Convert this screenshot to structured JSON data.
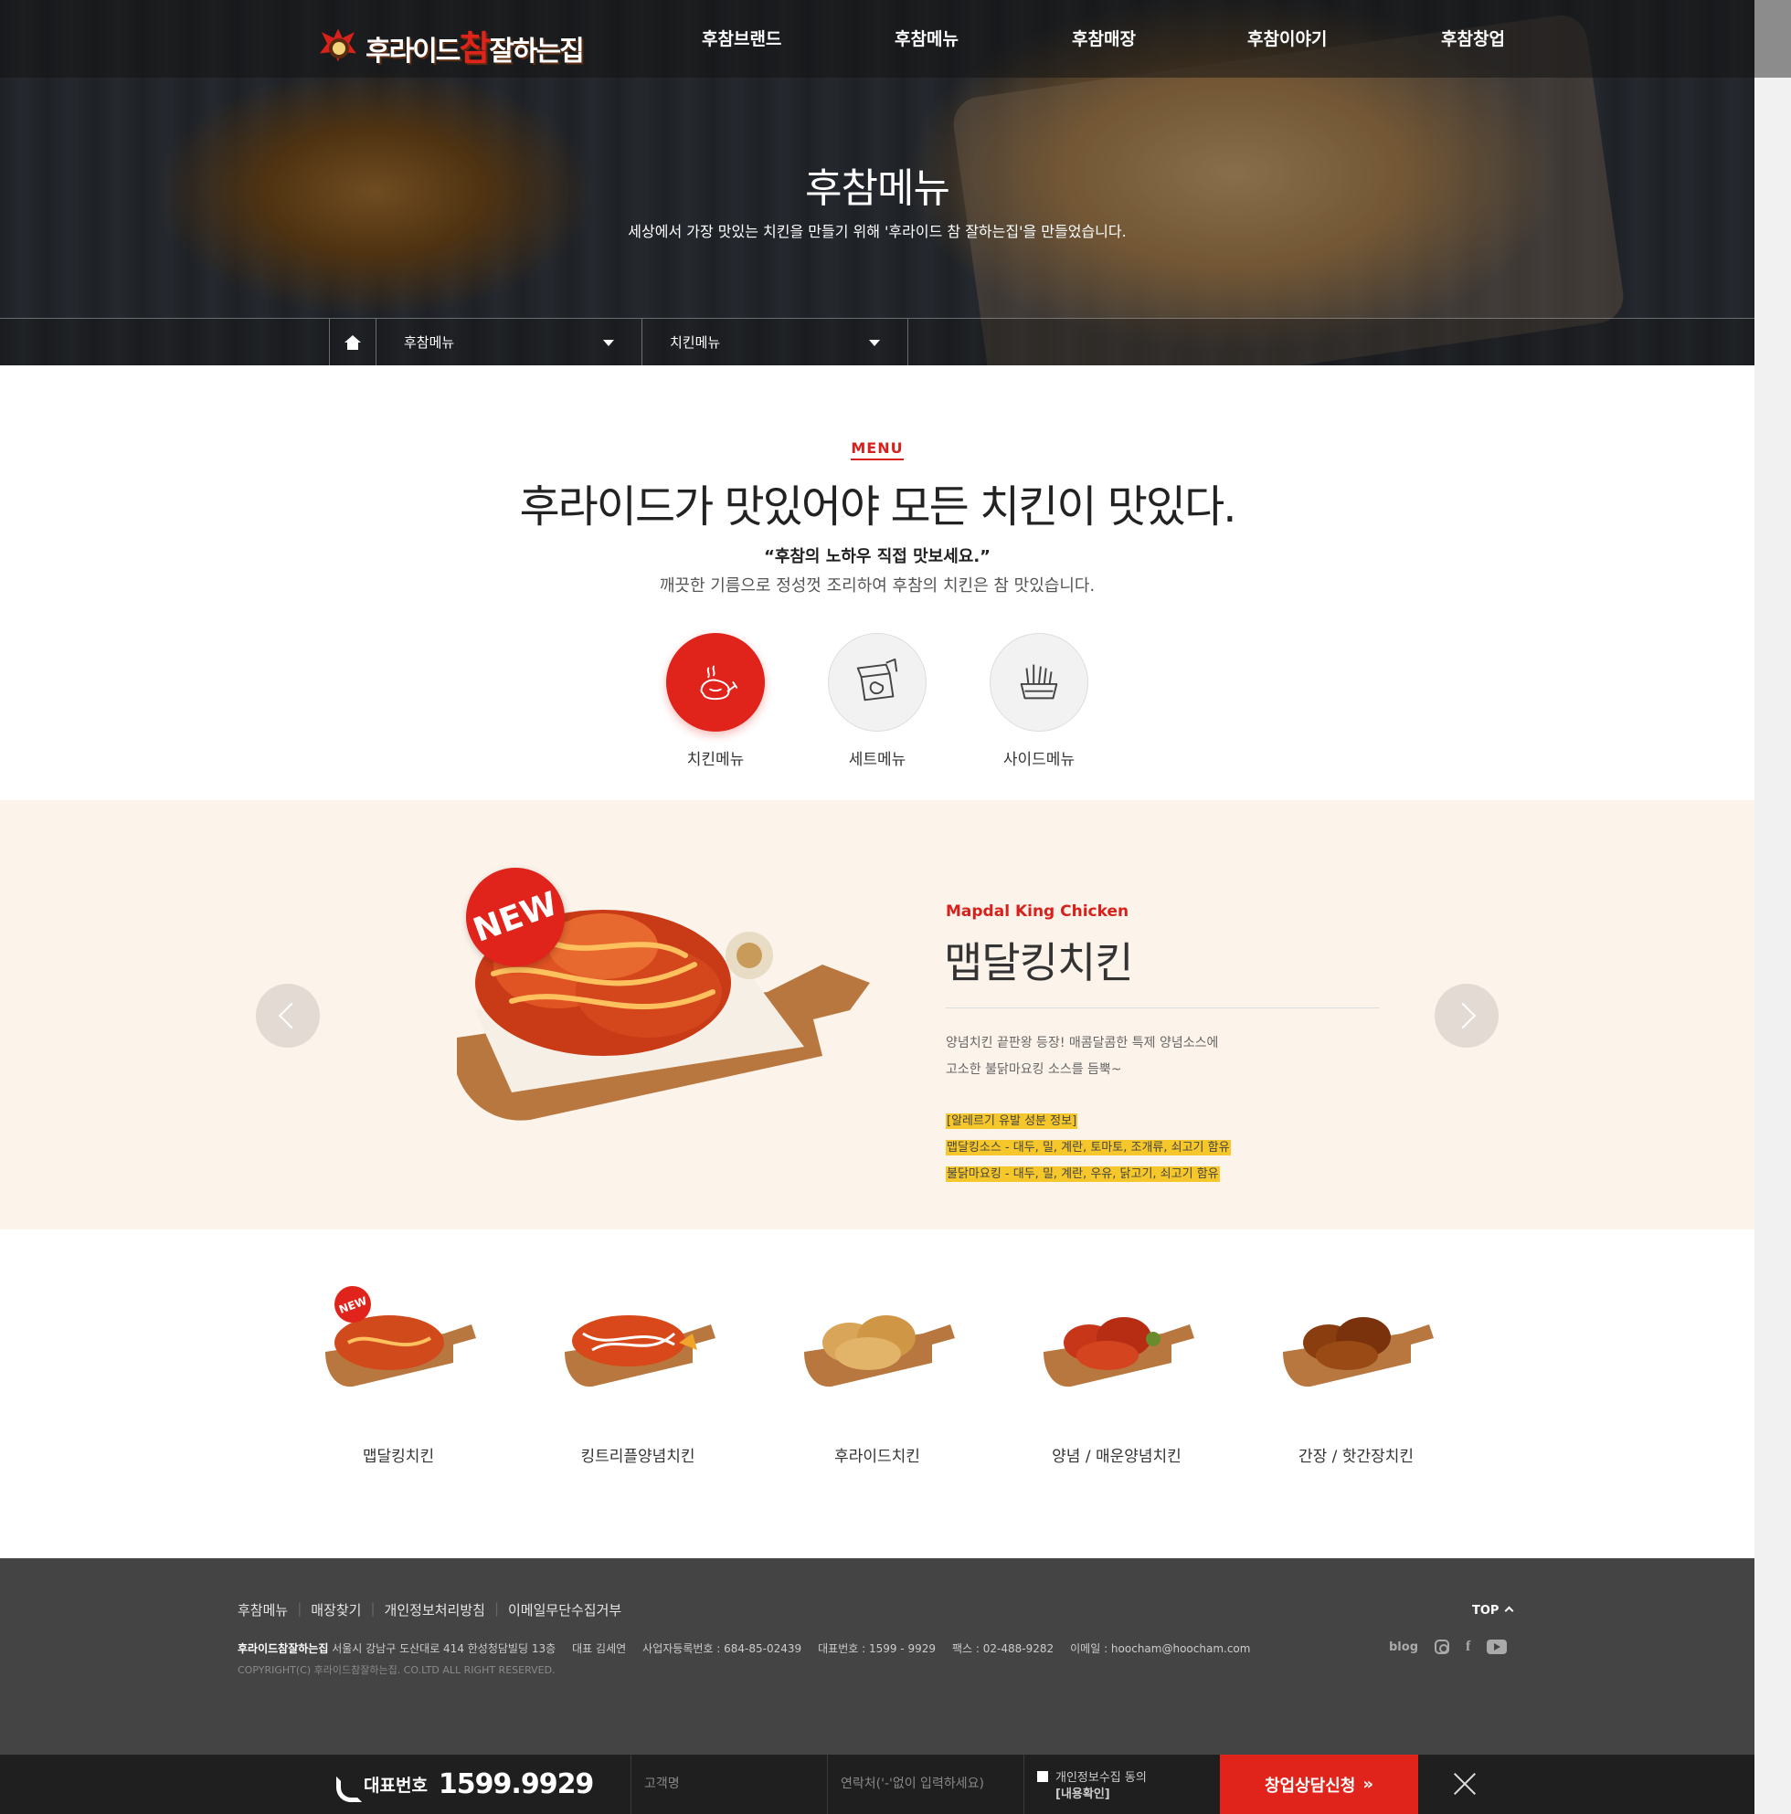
{
  "header": {
    "logo": {
      "prefix": "후라이드",
      "accent": "참",
      "suffix": "잘하는집"
    },
    "nav": [
      "후참브랜드",
      "후참메뉴",
      "후참매장",
      "후참이야기",
      "후참창업"
    ]
  },
  "hero": {
    "title": "후참메뉴",
    "subtitle": "세상에서 가장 맛있는 치킨을 만들기 위해 '후라이드 참 잘하는집'을 만들었습니다."
  },
  "location": {
    "depth1": "후참메뉴",
    "depth2": "치킨메뉴"
  },
  "intro": {
    "kicker": "MENU",
    "headline": "후라이드가 맛있어야 모든 치킨이 맛있다.",
    "quote": "“후참의 노하우 직접 맛보세요.”",
    "desc": "깨끗한 기름으로 정성껏 조리하여 후참의 치킨은 참 맛있습니다."
  },
  "categories": [
    {
      "label": "치킨메뉴",
      "icon": "chicken-leg-icon",
      "active": true
    },
    {
      "label": "세트메뉴",
      "icon": "set-box-icon",
      "active": false
    },
    {
      "label": "사이드메뉴",
      "icon": "fries-basket-icon",
      "active": false
    }
  ],
  "featured": {
    "badge": "NEW",
    "name_en": "Mapdal King Chicken",
    "name_ko": "맵달킹치킨",
    "desc1": "양념치킨 끝판왕 등장! 매콤달콤한 특제 양념소스에",
    "desc2": "고소한 불닭마요킹 소스를 듬뿍~",
    "allergy_title": "[알레르기 유발 성분 정보]",
    "allergy1": "맵달킹소스 - 대두, 밀, 계란, 토마토, 조개류, 쇠고기 함유",
    "allergy2": "불닭마요킹 - 대두, 밀, 계란, 우유, 닭고기, 쇠고기 함유"
  },
  "chicken_list": [
    {
      "name": "맵달킹치킨",
      "badge": "NEW"
    },
    {
      "name": "킹트리플양념치킨",
      "badge": ""
    },
    {
      "name": "후라이드치킨",
      "badge": ""
    },
    {
      "name": "양념 / 매운양념치킨",
      "badge": ""
    },
    {
      "name": "간장 / 핫간장치킨",
      "badge": ""
    }
  ],
  "footer": {
    "links": [
      "후참메뉴",
      "매장찾기",
      "개인정보처리방침",
      "이메일무단수집거부"
    ],
    "company": "후라이드참잘하는집",
    "address": "서울시 강남구 도산대로 414 한성청담빌딩 13층",
    "ceo": "대표 김세연",
    "biz_no": "사업자등록번호 : 684-85-02439",
    "tel": "대표번호 : 1599 - 9929",
    "fax": "팩스 : 02-488-9282",
    "email": "이메일 : hoocham@hoocham.com",
    "copyright": "COPYRIGHT(C) 후라이드참잘하는집. CO.LTD ALL RIGHT RESERVED.",
    "top": "TOP",
    "sns_blog": "blog",
    "sns_fb": "f"
  },
  "bottombar": {
    "phone_label": "대표번호",
    "phone_number": "1599.9929",
    "name_placeholder": "고객명",
    "contact_placeholder": "연락처('-'없이 입력하세요)",
    "agree_label": "개인정보수집 동의",
    "agree_link": "[내용확인]",
    "submit": "창업상담신청"
  },
  "colors": {
    "accent": "#e0231b",
    "featured_bg": "#fcf3ea",
    "footer_bg": "#444444",
    "bar_bg": "#1f1f1f",
    "highlight": "#f6c72a"
  }
}
